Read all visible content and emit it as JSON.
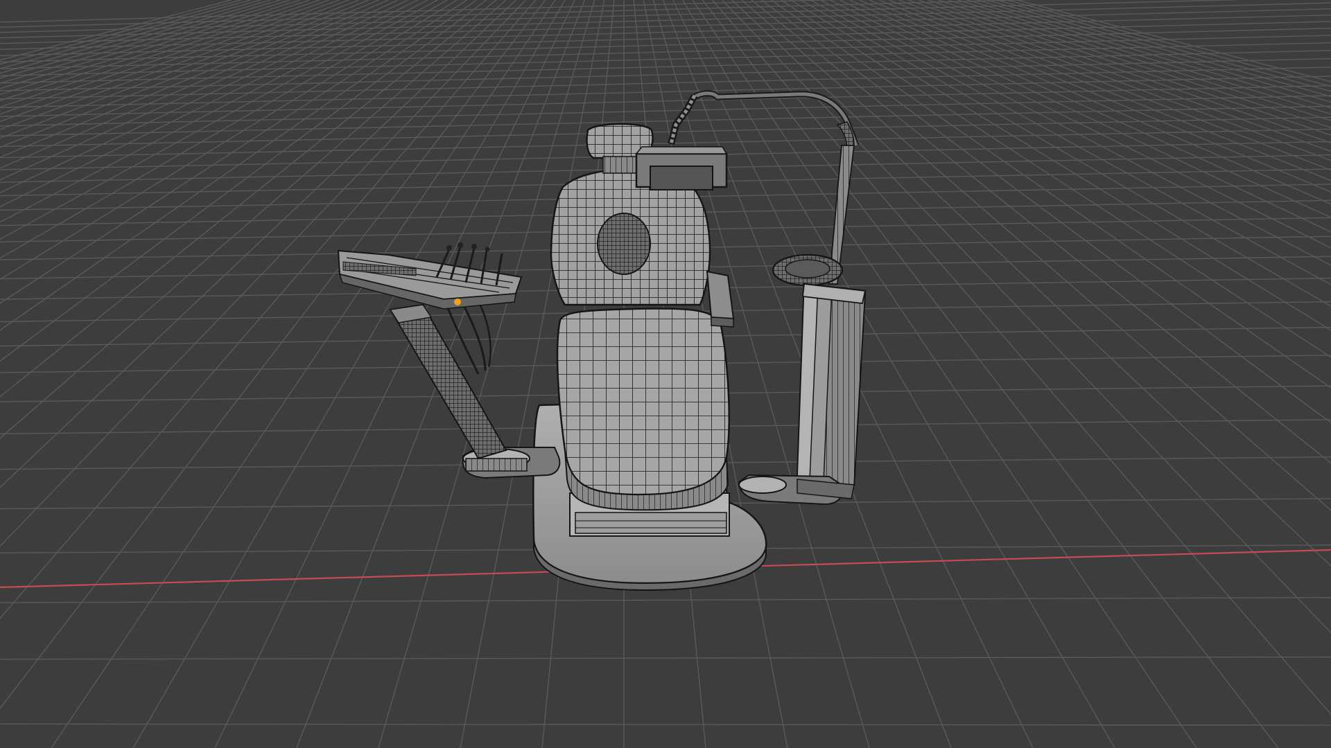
{
  "app": {
    "view": "3D Viewport",
    "shading": "wireframe-overlay"
  },
  "viewport": {
    "background_color": "#3d3d3d",
    "grid_color": "#5a5a5a",
    "x_axis_color": "#c84a55",
    "model": {
      "name": "dental-chair",
      "surface_color": "#9c9c9c",
      "wire_color": "#111111",
      "selected_vertex_color": "#f0a020"
    }
  }
}
